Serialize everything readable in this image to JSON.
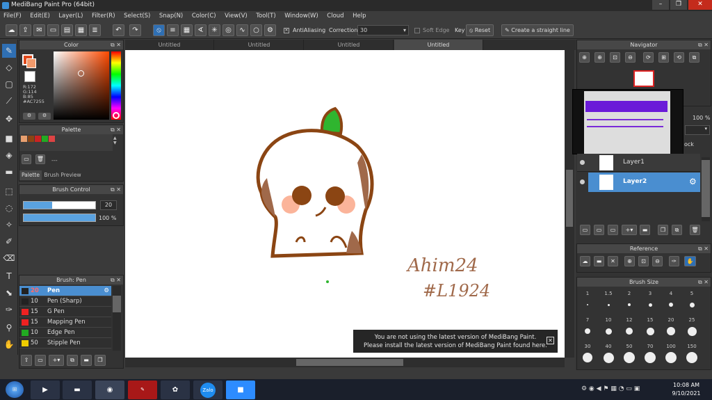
{
  "window": {
    "title": "MediBang Paint Pro (64bit)"
  },
  "menu": [
    "File(F)",
    "Edit(E)",
    "Layer(L)",
    "Filter(R)",
    "Select(S)",
    "Snap(N)",
    "Color(C)",
    "View(V)",
    "Tool(T)",
    "Window(W)",
    "Cloud",
    "Help"
  ],
  "toolbar": {
    "antialiasing": "AntiAliasing",
    "correction_label": "Correction",
    "correction_value": "30",
    "soft_edge": "Soft Edge",
    "key": "Key",
    "reset": "Reset",
    "straight_line": "Create a straight line"
  },
  "color_panel": {
    "title": "Color",
    "r": "R:172",
    "g": "G:114",
    "b": "B:85",
    "hex": "#AC7255",
    "fg": "#AC7255",
    "accent": "#2f6fb3"
  },
  "palette_panel": {
    "title": "Palette",
    "tab1": "Palette",
    "tab2": "Brush Preview",
    "swatches": [
      "#e8a070",
      "#8b4513",
      "#cc2222",
      "#22aa22",
      "#dd4444"
    ],
    "dash": "---"
  },
  "brush_control": {
    "title": "Brush Control",
    "size": "20",
    "opacity": "100 %"
  },
  "brush_panel": {
    "title": "Brush: Pen",
    "items": [
      {
        "size": "20",
        "name": "Pen",
        "color": "#222222"
      },
      {
        "size": "10",
        "name": "Pen (Sharp)",
        "color": "#222222"
      },
      {
        "size": "15",
        "name": "G Pen",
        "color": "#ee2222"
      },
      {
        "size": "15",
        "name": "Mapping Pen",
        "color": "#ee2222"
      },
      {
        "size": "10",
        "name": "Edge Pen",
        "color": "#22aa22"
      },
      {
        "size": "50",
        "name": "Stipple Pen",
        "color": "#eecc00"
      }
    ]
  },
  "tabs": [
    "Untitled",
    "Untitled",
    "Untitled",
    "Untitled"
  ],
  "canvas": {
    "signature1": "Ahim24",
    "signature2": "#L1924"
  },
  "notice": {
    "line1": "You are not using the latest version of MediBang Paint.",
    "line2": "Please install the latest version of MediBang Paint found here."
  },
  "navigator": {
    "title": "Navigator"
  },
  "layers": {
    "opacity": "100 %",
    "lock": "ock",
    "layer1": "Layer1",
    "layer2": "Layer2"
  },
  "reference": {
    "title": "Reference"
  },
  "brush_size": {
    "title": "Brush Size",
    "sizes": [
      "1",
      "1.5",
      "2",
      "3",
      "4",
      "5",
      "7",
      "10",
      "12",
      "15",
      "20",
      "25",
      "30",
      "40",
      "50",
      "70",
      "100",
      "150"
    ]
  },
  "taskbar": {
    "time": "10:08 AM",
    "date": "9/10/2021",
    "zalo": "Zalo"
  }
}
